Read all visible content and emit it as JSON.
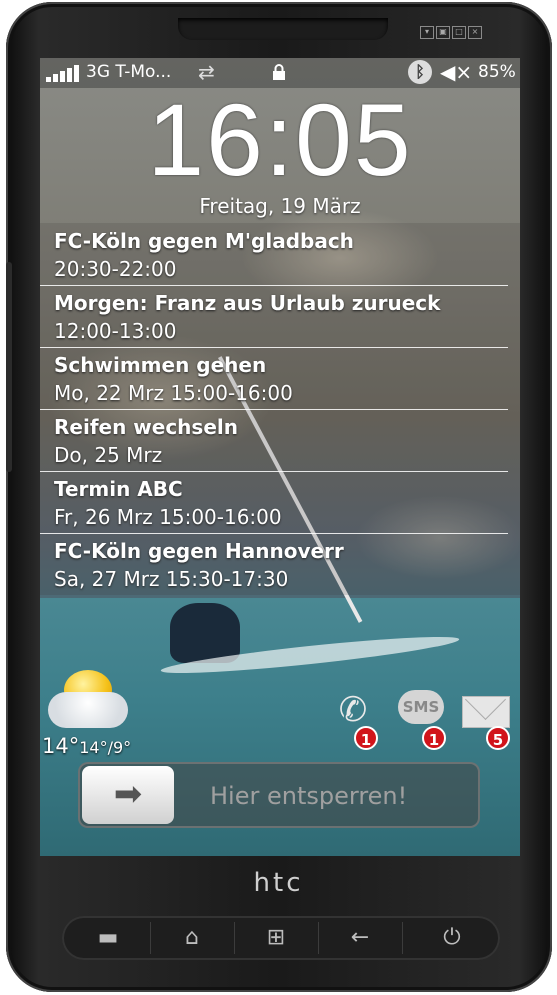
{
  "status_bar": {
    "carrier": "3G T-Mo...",
    "battery": "85%"
  },
  "lock_screen": {
    "time": "16:05",
    "date": "Freitag, 19 März",
    "events": [
      {
        "title": "FC-Köln gegen M'gladbach",
        "time": "20:30-22:00"
      },
      {
        "title": "Morgen: Franz aus Urlaub zurueck",
        "time": "12:00-13:00"
      },
      {
        "title": "Schwimmen gehen",
        "time": "Mo, 22 Mrz 15:00-16:00"
      },
      {
        "title": "Reifen wechseln",
        "time": "Do, 25 Mrz"
      },
      {
        "title": "Termin ABC",
        "time": "Fr, 26 Mrz 15:00-16:00"
      },
      {
        "title": "FC-Köln gegen Hannoverr",
        "time": "Sa, 27 Mrz 15:30-17:30"
      }
    ],
    "weather": {
      "icon": "partly-cloudy-icon",
      "current": "14°",
      "range": "14°/9°"
    },
    "notifications": {
      "calls": {
        "icon": "phone-icon",
        "count": "1"
      },
      "sms": {
        "icon": "sms-icon",
        "label": "SMS",
        "count": "1"
      },
      "mail": {
        "icon": "mail-icon",
        "count": "5"
      }
    },
    "unlock_label": "Hier entsperren!"
  },
  "device": {
    "brand": "htc"
  },
  "colors": {
    "badge": "#d1141b",
    "text": "#ffffff"
  }
}
